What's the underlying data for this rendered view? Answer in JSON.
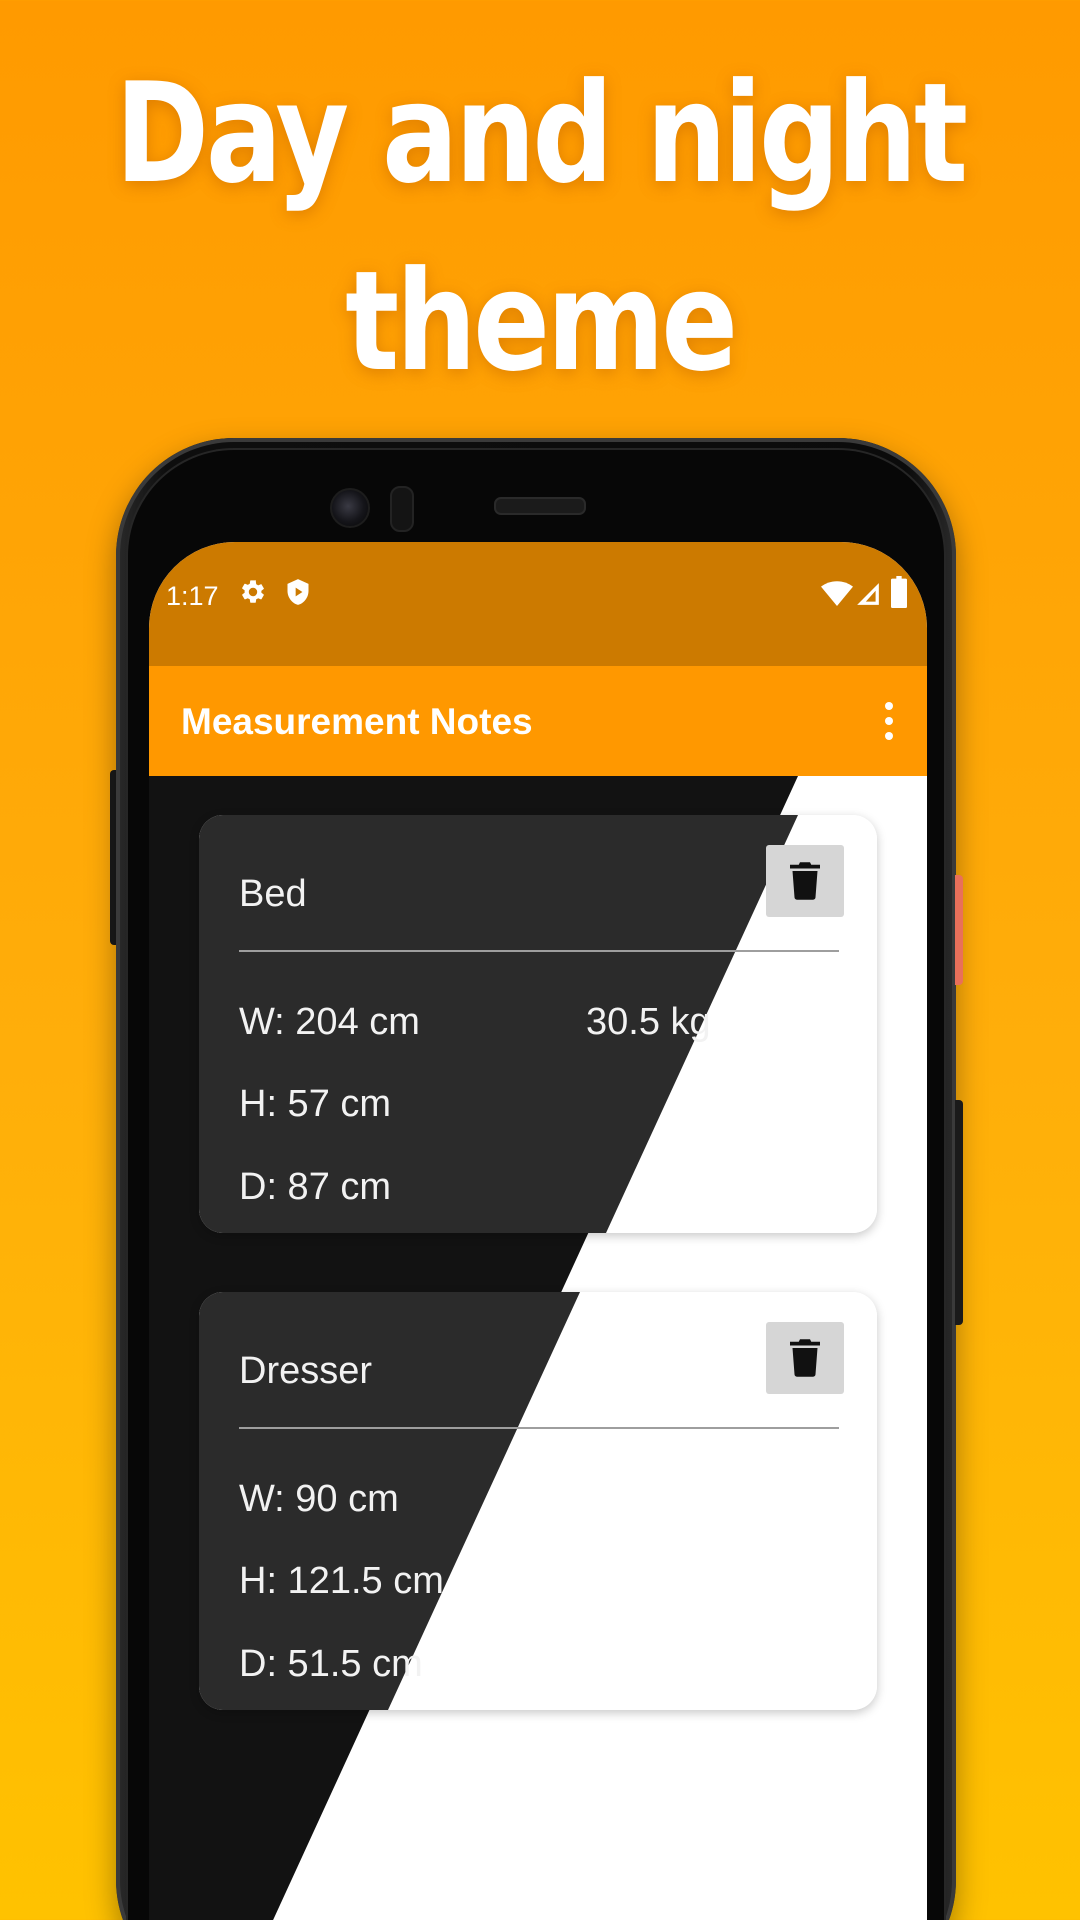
{
  "headline": {
    "line1": "Day and night",
    "line2": "theme"
  },
  "status_bar": {
    "time": "1:17",
    "icons": [
      "settings-icon",
      "shield-icon",
      "wifi-icon",
      "cellular-signal-icon",
      "battery-icon"
    ]
  },
  "app_bar": {
    "title": "Measurement Notes",
    "menu_icon": "more-vert-icon"
  },
  "notes": [
    {
      "title": "Bed",
      "width": "W: 204 cm",
      "height": "H: 57 cm",
      "depth": "D: 87 cm",
      "weight": "30.5 kg",
      "delete_icon": "trash-icon"
    },
    {
      "title": "Dresser",
      "width": "W: 90 cm",
      "height": "H: 121.5 cm",
      "depth": "D: 51.5 cm",
      "weight": "",
      "delete_icon": "trash-icon"
    }
  ],
  "colors": {
    "background_top": "#ff9a00",
    "background_bottom": "#ffc200",
    "status_bar": "#cc7a00",
    "app_bar": "#ff9800",
    "dark_background": "#121212",
    "dark_card": "#2b2b2b",
    "light_background": "#ffffff",
    "light_card": "#ffffff"
  }
}
